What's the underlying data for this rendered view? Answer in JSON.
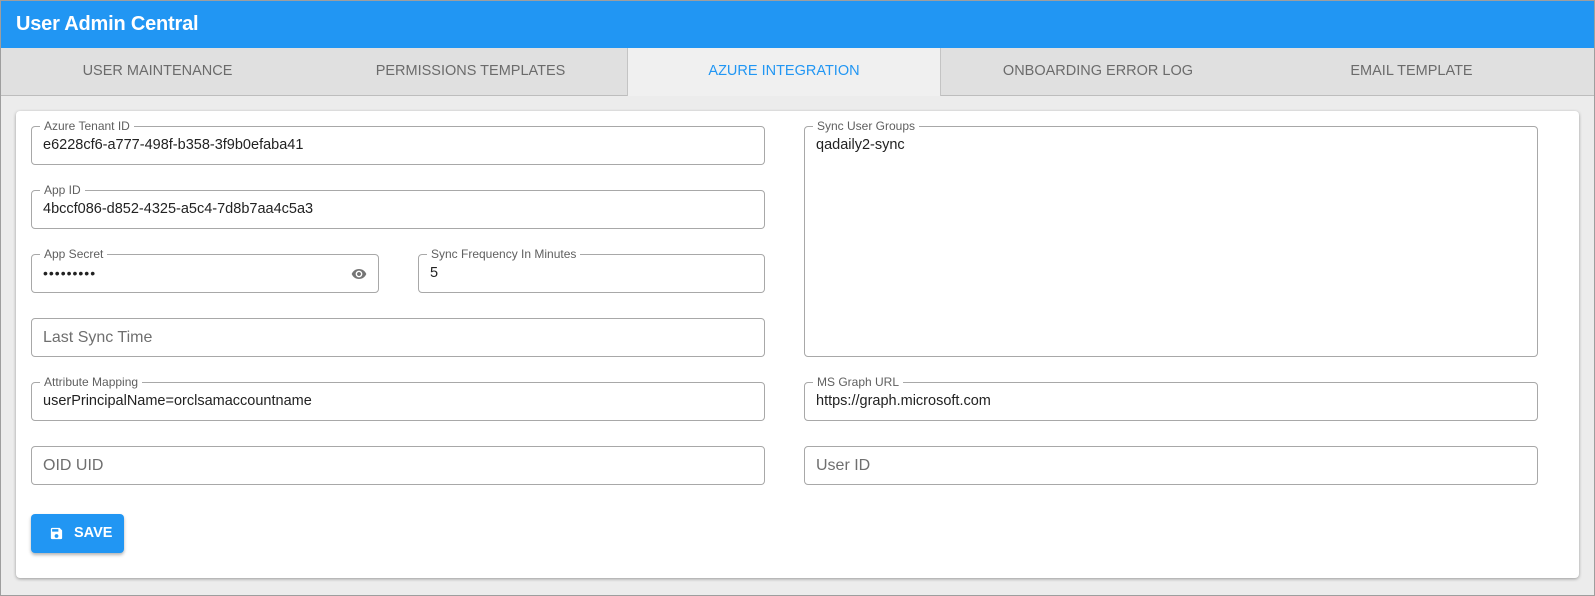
{
  "app": {
    "title": "User Admin Central"
  },
  "tabs": [
    {
      "label": "USER MAINTENANCE"
    },
    {
      "label": "PERMISSIONS TEMPLATES"
    },
    {
      "label": "AZURE INTEGRATION",
      "active": true
    },
    {
      "label": "ONBOARDING ERROR LOG"
    },
    {
      "label": "EMAIL TEMPLATE"
    }
  ],
  "form": {
    "tenant_id": {
      "label": "Azure Tenant ID",
      "value": "e6228cf6-a777-498f-b358-3f9b0efaba41"
    },
    "app_id": {
      "label": "App ID",
      "value": "4bccf086-d852-4325-a5c4-7d8b7aa4c5a3"
    },
    "app_secret": {
      "label": "App Secret",
      "value": "•••••••••"
    },
    "sync_frequency": {
      "label": "Sync Frequency In Minutes",
      "value": "5"
    },
    "last_sync_time": {
      "placeholder": "Last Sync Time"
    },
    "sync_user_groups": {
      "label": "Sync User Groups",
      "value": "qadaily2-sync"
    },
    "attribute_mapping": {
      "label": "Attribute Mapping",
      "value": "userPrincipalName=orclsamaccountname"
    },
    "ms_graph_url": {
      "label": "MS Graph URL",
      "value": "https://graph.microsoft.com"
    },
    "oid_uid": {
      "placeholder": "OID UID"
    },
    "user_id": {
      "placeholder": "User ID"
    }
  },
  "actions": {
    "save_label": "SAVE"
  },
  "icons": {
    "eye": "eye-icon",
    "save": "floppy-disk-icon"
  },
  "colors": {
    "primary": "#2196f3"
  }
}
